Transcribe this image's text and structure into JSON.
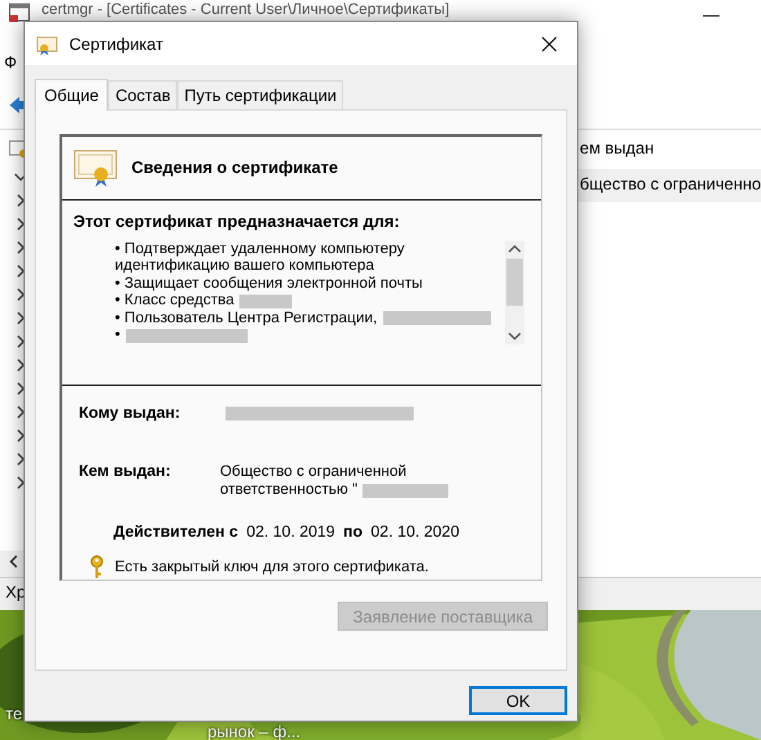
{
  "background_window": {
    "title": "certmgr - [Certificates - Current User\\Личное\\Сертификаты]",
    "menu": "Ф",
    "tree": [
      {
        "expanded": true
      },
      {
        "expanded": false
      },
      {
        "expanded": false
      },
      {
        "expanded": false
      },
      {
        "expanded": false
      },
      {
        "expanded": false
      },
      {
        "expanded": false
      },
      {
        "expanded": false
      },
      {
        "expanded": false
      },
      {
        "expanded": false
      },
      {
        "expanded": false
      },
      {
        "expanded": false
      },
      {
        "expanded": false
      },
      {
        "expanded": false
      }
    ],
    "column_header": "ем выдан",
    "row_cell": "бщество с ограниченно",
    "status": "Хр"
  },
  "desktop": {
    "icons": [
      {
        "label": "те"
      },
      {
        "label": "рынок – ф..."
      }
    ]
  },
  "dialog": {
    "title": "Сертификат",
    "tabs": [
      {
        "label": "Общие",
        "selected": true
      },
      {
        "label": "Состав",
        "selected": false
      },
      {
        "label": "Путь сертификации",
        "selected": false
      }
    ],
    "heading": "Сведения о сертификате",
    "purpose_title": "Этот сертификат предназначается для:",
    "purposes": [
      {
        "bullet": "•",
        "text": "Подтверждает удаленному компьютеру идентификацию вашего компьютера",
        "redacted": false
      },
      {
        "bullet": "•",
        "text": "Защищает сообщения электронной почты",
        "redacted": false
      },
      {
        "bullet": "•",
        "text": "Класс средства",
        "redacted": true
      },
      {
        "bullet": "•",
        "text": "Пользователь Центра Регистрации,",
        "redacted": true
      },
      {
        "bullet": "•",
        "redacted": true
      }
    ],
    "issued_to": {
      "label": "Кому выдан:",
      "redacted": true
    },
    "issued_by": {
      "label": "Кем выдан:",
      "lines": [
        "Общество с ограниченной",
        "ответственностью \""
      ],
      "redacted": true
    },
    "validity": {
      "from_label": "Действителен с",
      "from": "02. 10. 2019",
      "to_label": "по",
      "to": "02. 10. 2020"
    },
    "key_note": "Есть закрытый ключ для этого сертификата.",
    "buttons": [
      {
        "label": "Заявление поставщика",
        "disabled": true,
        "default": false
      },
      {
        "label": "OK",
        "disabled": false,
        "default": true
      }
    ]
  }
}
